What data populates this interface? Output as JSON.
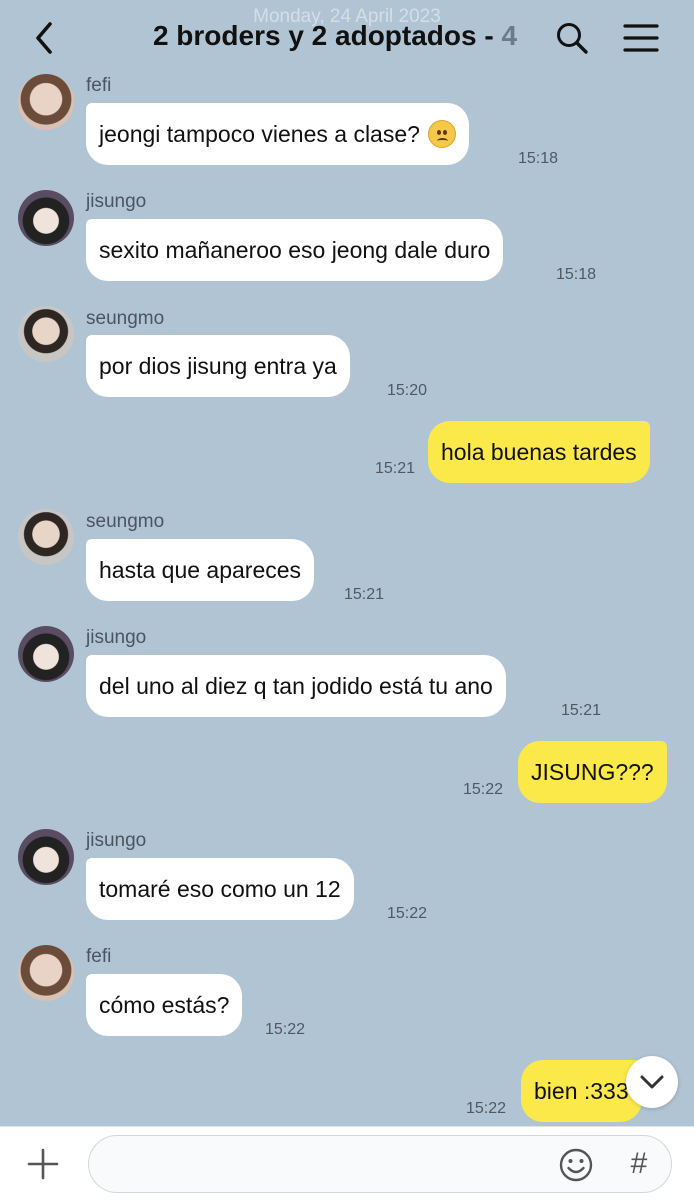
{
  "header": {
    "date_overlay": "Monday, 24 April 2023",
    "title": "2 broders y 2 adoptados - ",
    "member_count": "4",
    "icons": {
      "back": "chevron-left-icon",
      "search": "search-icon",
      "menu": "hamburger-menu-icon"
    }
  },
  "messages": [
    {
      "sender": "fefi",
      "text": "jeongi tampoco vienes a clase?",
      "emoji": "slightly-frowning-face",
      "time": "15:18"
    },
    {
      "sender": "jisungo",
      "text": "sexito mañaneroo eso jeong dale duro",
      "time": "15:18"
    },
    {
      "sender": "seungmo",
      "text": "por dios jisung entra ya",
      "time": "15:20"
    },
    {
      "sender": "me",
      "text": "hola buenas tardes",
      "time": "15:21"
    },
    {
      "sender": "seungmo",
      "text": "hasta que apareces",
      "time": "15:21"
    },
    {
      "sender": "jisungo",
      "text": "del uno al diez q tan jodido está tu ano",
      "time": "15:21"
    },
    {
      "sender": "me",
      "text": "JISUNG???",
      "time": "15:22"
    },
    {
      "sender": "jisungo",
      "text": "tomaré eso como un 12",
      "time": "15:22"
    },
    {
      "sender": "fefi",
      "text": "cómo estás?",
      "time": "15:22"
    },
    {
      "sender": "me",
      "text": "bien :333",
      "time": "15:22"
    }
  ],
  "input_bar": {
    "placeholder": "",
    "hash_label": "#",
    "icons": {
      "plus": "plus-icon",
      "emoji": "emoji-icon",
      "hash": "hashtag-icon",
      "scroll_down": "chevron-down-icon"
    }
  },
  "colors": {
    "background": "#b1c4d4",
    "incoming_bubble": "#ffffff",
    "outgoing_bubble": "#fbe94a"
  }
}
